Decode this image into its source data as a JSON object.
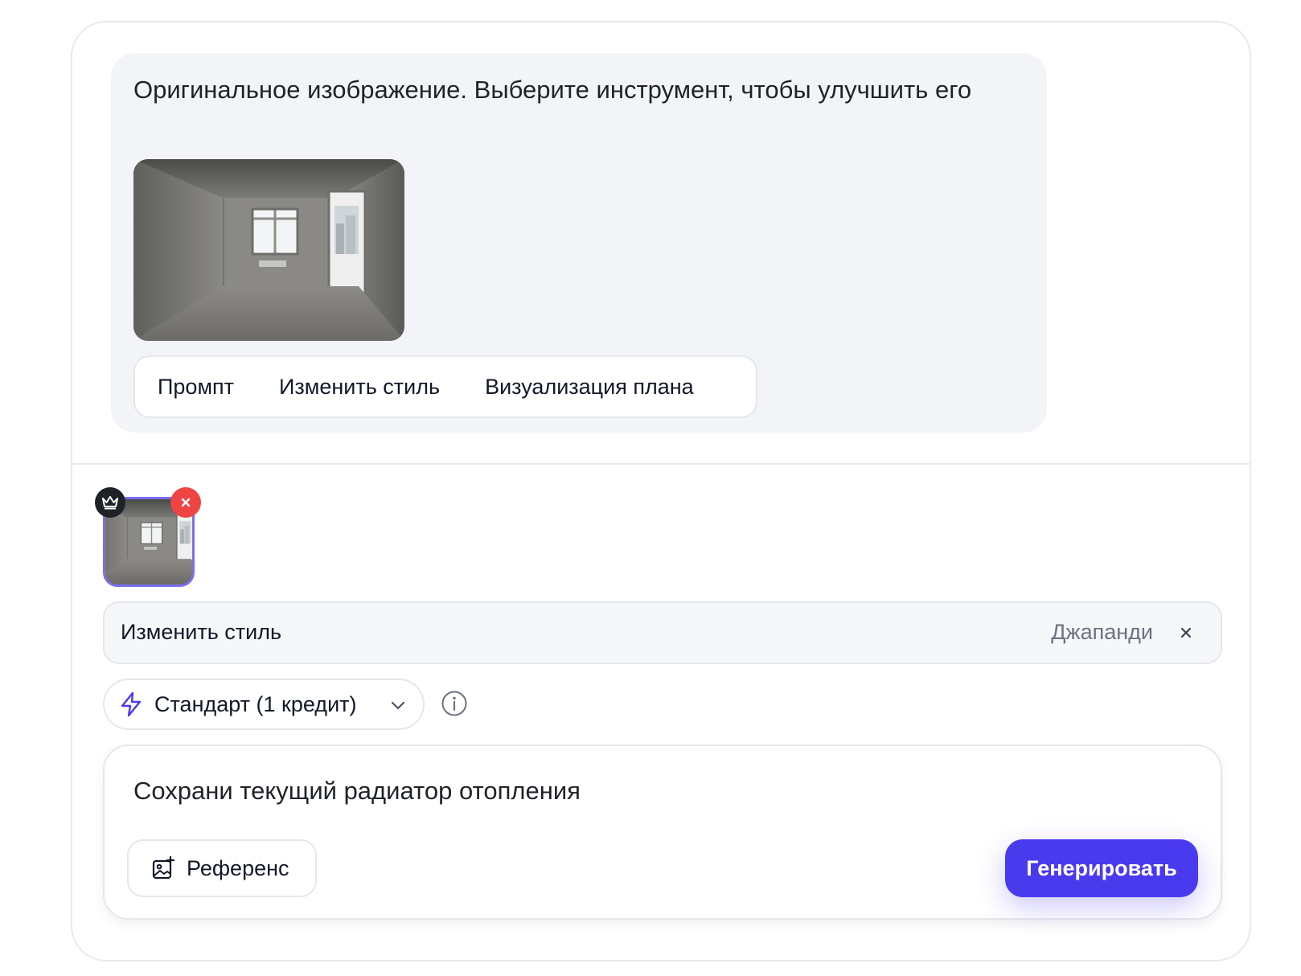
{
  "message": {
    "text": "Оригинальное изображение. Выберите инструмент, чтобы улучшить его",
    "image_icon": "room-photo",
    "tools": [
      {
        "label": "Промпт"
      },
      {
        "label": "Изменить стиль"
      },
      {
        "label": "Визуализация плана"
      }
    ]
  },
  "attachment": {
    "badge_icon": "crown-icon",
    "remove_icon": "close-icon"
  },
  "style_bar": {
    "label": "Изменить стиль",
    "value": "Джапанди"
  },
  "mode": {
    "label": "Стандарт (1 кредит)",
    "icon": "lightning-icon"
  },
  "prompt": {
    "text": "Сохрани текущий радиатор отопления",
    "reference_label": "Референс",
    "generate_label": "Генерировать"
  },
  "colors": {
    "accent": "#4a3aee",
    "remove": "#ef4444",
    "selected_border": "#7c6df2"
  }
}
